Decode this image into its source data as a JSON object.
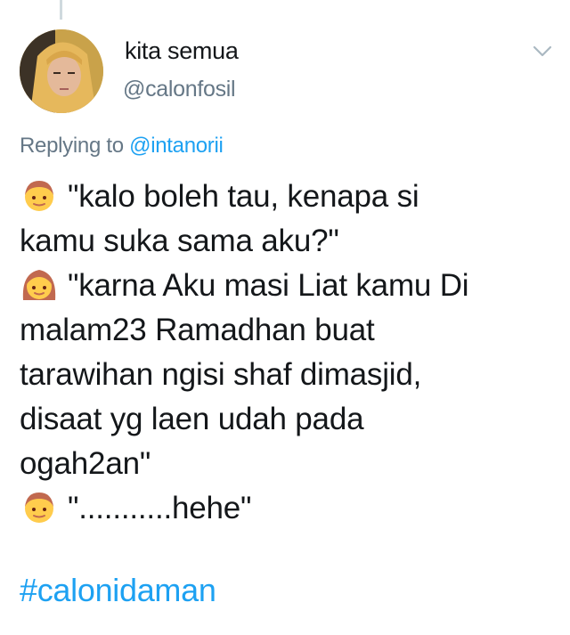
{
  "tweet": {
    "author": {
      "display_name": "kita semua",
      "handle": "@calonfosil"
    },
    "reply_context": {
      "prefix": "Replying to",
      "mention": "@intanorii"
    },
    "lines": [
      {
        "emoji": "boy-emoji",
        "text": "\"kalo boleh tau, kenapa si"
      },
      {
        "emoji": null,
        "text": "kamu suka sama aku?\""
      },
      {
        "emoji": "girl-emoji",
        "text": "\"karna Aku masi Liat kamu Di"
      },
      {
        "emoji": null,
        "text": "malam23 Ramadhan buat"
      },
      {
        "emoji": null,
        "text": "tarawihan ngisi shaf dimasjid,"
      },
      {
        "emoji": null,
        "text": "disaat yg laen udah pada"
      },
      {
        "emoji": null,
        "text": "ogah2an\""
      },
      {
        "emoji": "boy-emoji",
        "text": "\"...........hehe\""
      }
    ],
    "hashtag": "#calonidaman",
    "icons": {
      "menu": "chevron-down-icon",
      "avatar": "profile-avatar"
    },
    "colors": {
      "link": "#1da1f2",
      "secondary_text": "#657786",
      "primary_text": "#14171a"
    }
  }
}
